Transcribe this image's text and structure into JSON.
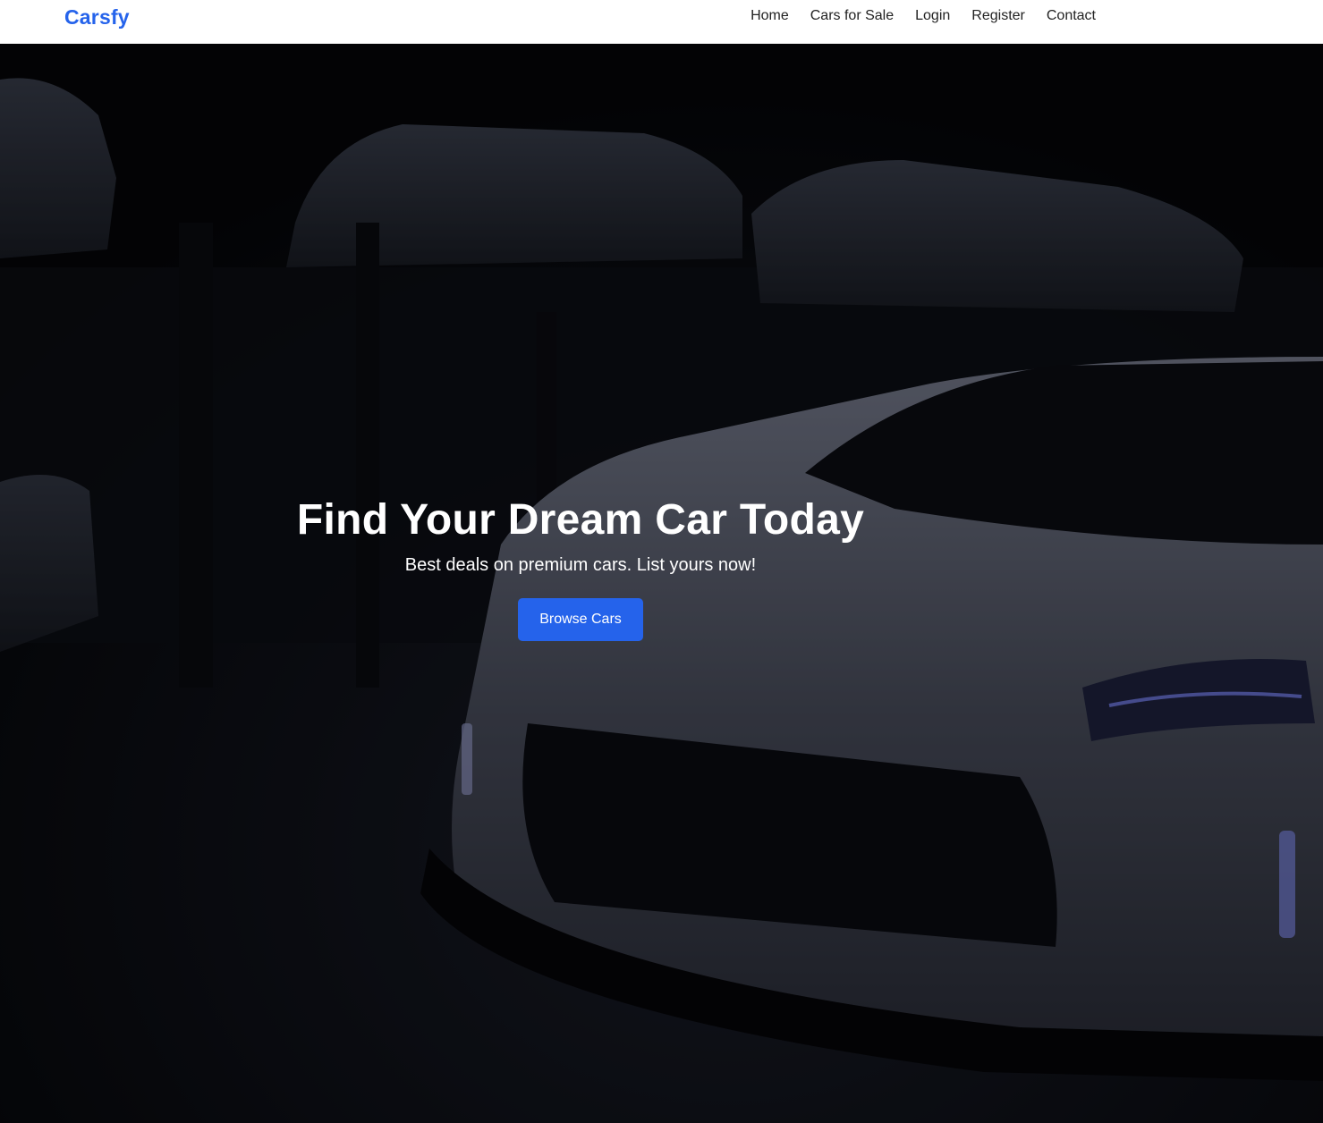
{
  "nav": {
    "brand": "Carsfy",
    "links": [
      "Home",
      "Cars for Sale",
      "Login",
      "Register",
      "Contact"
    ]
  },
  "hero": {
    "title": "Find Your Dream Car Today",
    "subtitle": "Best deals on premium cars. List yours now!",
    "cta_label": "Browse Cars",
    "background_image": "dark showroom with sports cars"
  },
  "colors": {
    "brand": "#2563eb",
    "cta": "#2563eb",
    "hero_overlay": "#07080d"
  }
}
